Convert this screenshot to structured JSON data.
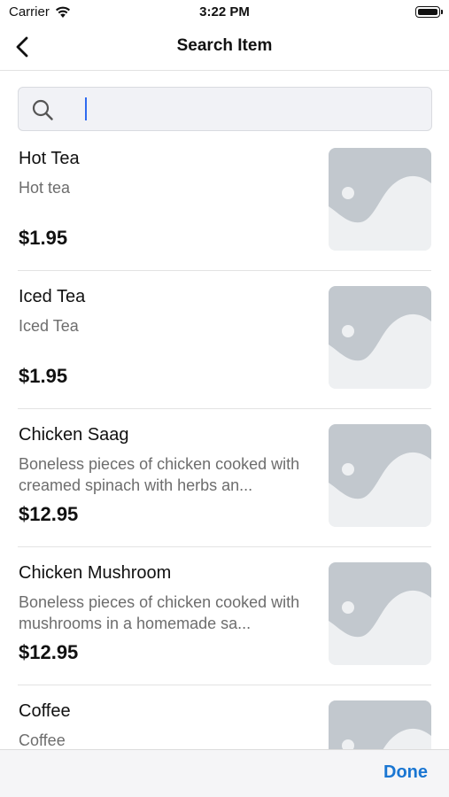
{
  "status_bar": {
    "carrier": "Carrier",
    "time": "3:22 PM",
    "wifi_icon": "wifi-icon",
    "battery_icon": "battery-icon",
    "battery_level": 1.0
  },
  "nav": {
    "title": "Search Item",
    "back_icon": "chevron-left-icon"
  },
  "search": {
    "value": "",
    "placeholder": "",
    "icon": "search-icon",
    "caret_color": "#2f6bf0"
  },
  "items": [
    {
      "name": "Hot Tea",
      "description": "Hot tea",
      "price": "$1.95",
      "image_icon": "image-placeholder-icon"
    },
    {
      "name": "Iced Tea",
      "description": "Iced Tea",
      "price": "$1.95",
      "image_icon": "image-placeholder-icon"
    },
    {
      "name": "Chicken Saag",
      "description": "Boneless pieces of chicken cooked with creamed spinach with herbs an...",
      "price": "$12.95",
      "image_icon": "image-placeholder-icon"
    },
    {
      "name": "Chicken Mushroom",
      "description": "Boneless pieces of chicken cooked with mushrooms in a homemade sa...",
      "price": "$12.95",
      "image_icon": "image-placeholder-icon"
    },
    {
      "name": "Coffee",
      "description": "Coffee",
      "price": "",
      "image_icon": "image-placeholder-icon"
    }
  ],
  "toolbar": {
    "done_label": "Done",
    "accent": "#1a76d2"
  },
  "colors": {
    "placeholder_bg": "#eef0f2",
    "placeholder_fg": "#c2c8ce"
  }
}
